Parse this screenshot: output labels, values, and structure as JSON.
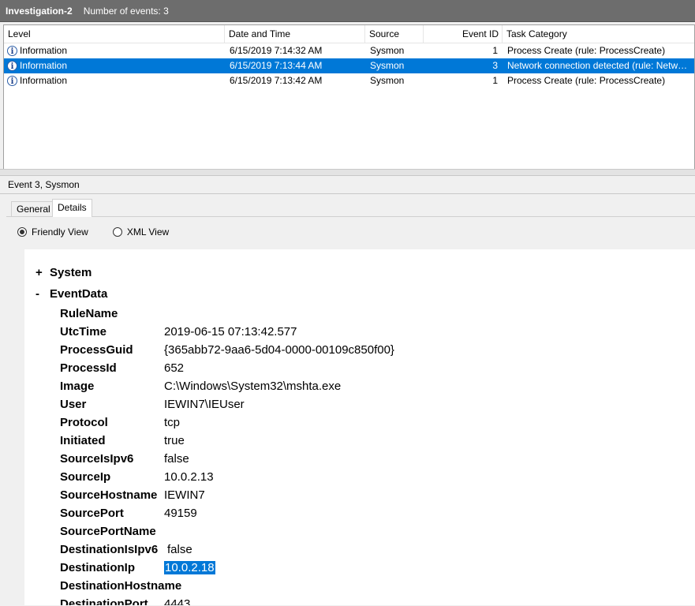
{
  "title": {
    "name": "Investigation-2",
    "count_label": "Number of events: 3"
  },
  "columns": [
    "Level",
    "Date and Time",
    "Source",
    "Event ID",
    "Task Category"
  ],
  "rows": [
    {
      "level": "Information",
      "date": "6/15/2019 7:14:32 AM",
      "source": "Sysmon",
      "event_id": "1",
      "task": "Process Create (rule: ProcessCreate)",
      "selected": false
    },
    {
      "level": "Information",
      "date": "6/15/2019 7:13:44 AM",
      "source": "Sysmon",
      "event_id": "3",
      "task": "Network connection detected (rule: Netw…",
      "selected": true
    },
    {
      "level": "Information",
      "date": "6/15/2019 7:13:42 AM",
      "source": "Sysmon",
      "event_id": "1",
      "task": "Process Create (rule: ProcessCreate)",
      "selected": false
    }
  ],
  "event_header": "Event 3, Sysmon",
  "tabs": {
    "general": "General",
    "details": "Details",
    "active": "Details"
  },
  "views": {
    "friendly": "Friendly View",
    "xml": "XML View",
    "selected": "Friendly View"
  },
  "tree": {
    "system": {
      "sym": "+",
      "label": "System"
    },
    "eventdata": {
      "sym": "-",
      "label": "EventData"
    }
  },
  "fields": [
    {
      "name": "RuleName",
      "value": ""
    },
    {
      "name": "UtcTime",
      "value": "2019-06-15 07:13:42.577"
    },
    {
      "name": "ProcessGuid",
      "value": "{365abb72-9aa6-5d04-0000-00109c850f00}"
    },
    {
      "name": "ProcessId",
      "value": "652"
    },
    {
      "name": "Image",
      "value": "C:\\Windows\\System32\\mshta.exe"
    },
    {
      "name": "User",
      "value": "IEWIN7\\IEUser"
    },
    {
      "name": "Protocol",
      "value": "tcp"
    },
    {
      "name": "Initiated",
      "value": "true"
    },
    {
      "name": "SourceIsIpv6",
      "value": "false"
    },
    {
      "name": "SourceIp",
      "value": "10.0.2.13"
    },
    {
      "name": "SourceHostname",
      "value": "IEWIN7"
    },
    {
      "name": "SourcePort",
      "value": "49159"
    },
    {
      "name": "SourcePortName",
      "value": ""
    },
    {
      "name": "DestinationIsIpv6",
      "value": "false"
    },
    {
      "name": "DestinationIp",
      "value": "10.0.2.18",
      "highlighted": true
    },
    {
      "name": "DestinationHostname",
      "value": ""
    },
    {
      "name": "DestinationPort",
      "value": "4443"
    }
  ]
}
